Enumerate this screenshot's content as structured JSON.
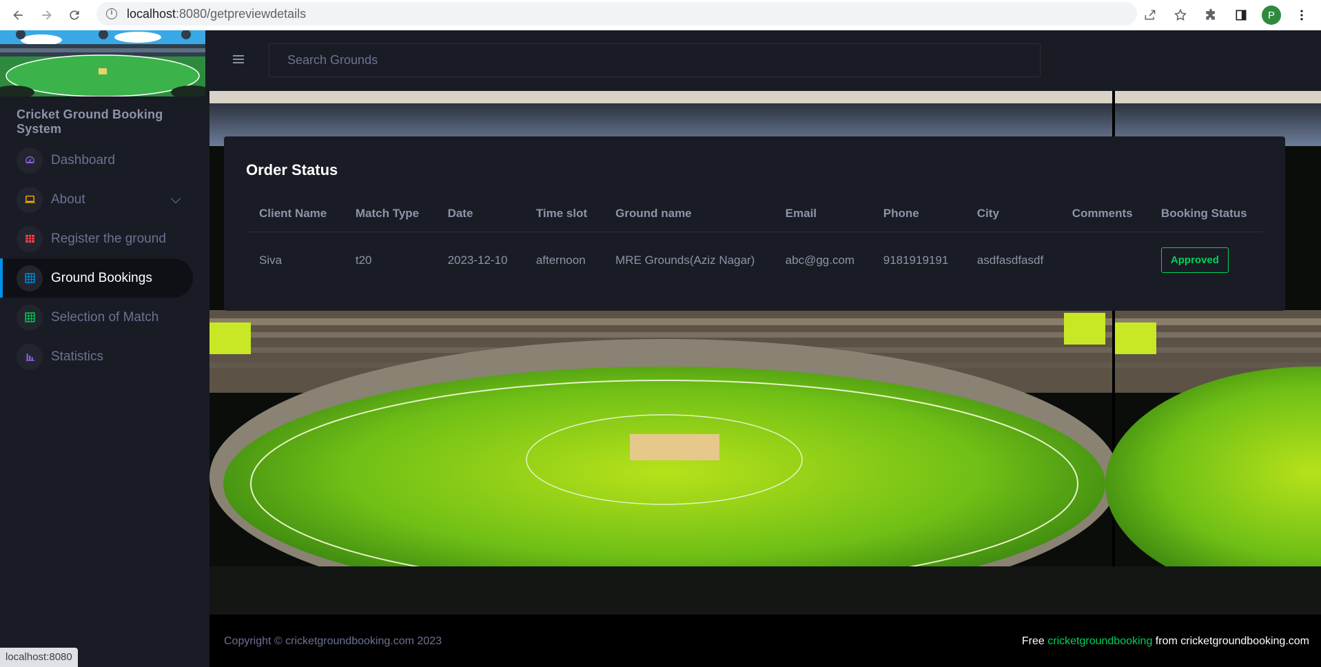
{
  "browser": {
    "url_host": "localhost",
    "url_path": ":8080/getpreviewdetails",
    "profile_initial": "P",
    "status_url": "localhost:8080"
  },
  "sidebar": {
    "brand_title": "Cricket Ground Booking System",
    "items": [
      {
        "label": "Dashboard",
        "icon": "speedometer-icon",
        "color": "#8f5fe8"
      },
      {
        "label": "About",
        "icon": "laptop-icon",
        "color": "#ffab00"
      },
      {
        "label": "Register the ground",
        "icon": "table-icon",
        "color": "#fc424a"
      },
      {
        "label": "Ground Bookings",
        "icon": "grid-icon",
        "color": "#0090e7"
      },
      {
        "label": "Selection of Match",
        "icon": "grid-icon",
        "color": "#00d25b"
      },
      {
        "label": "Statistics",
        "icon": "chart-bar-icon",
        "color": "#8f5fe8"
      }
    ]
  },
  "topbar": {
    "search_placeholder": "Search Grounds"
  },
  "order": {
    "title": "Order Status",
    "columns": [
      "Client Name",
      "Match Type",
      "Date",
      "Time slot",
      "Ground name",
      "Email",
      "Phone",
      "City",
      "Comments",
      "Booking Status"
    ],
    "rows": [
      {
        "client_name": "Siva",
        "match_type": "t20",
        "date": "2023-12-10",
        "time_slot": "afternoon",
        "ground_name": "MRE Grounds(Aziz Nagar)",
        "email": "abc@gg.com",
        "phone": "9181919191",
        "city": "asdfasdfasdf",
        "comments": "",
        "status": "Approved"
      }
    ]
  },
  "footer": {
    "copyright": "Copyright © cricketgroundbooking.com 2023",
    "free_prefix": "Free ",
    "free_link": "cricketgroundbooking",
    "free_suffix": " from cricketgroundbooking.com"
  }
}
